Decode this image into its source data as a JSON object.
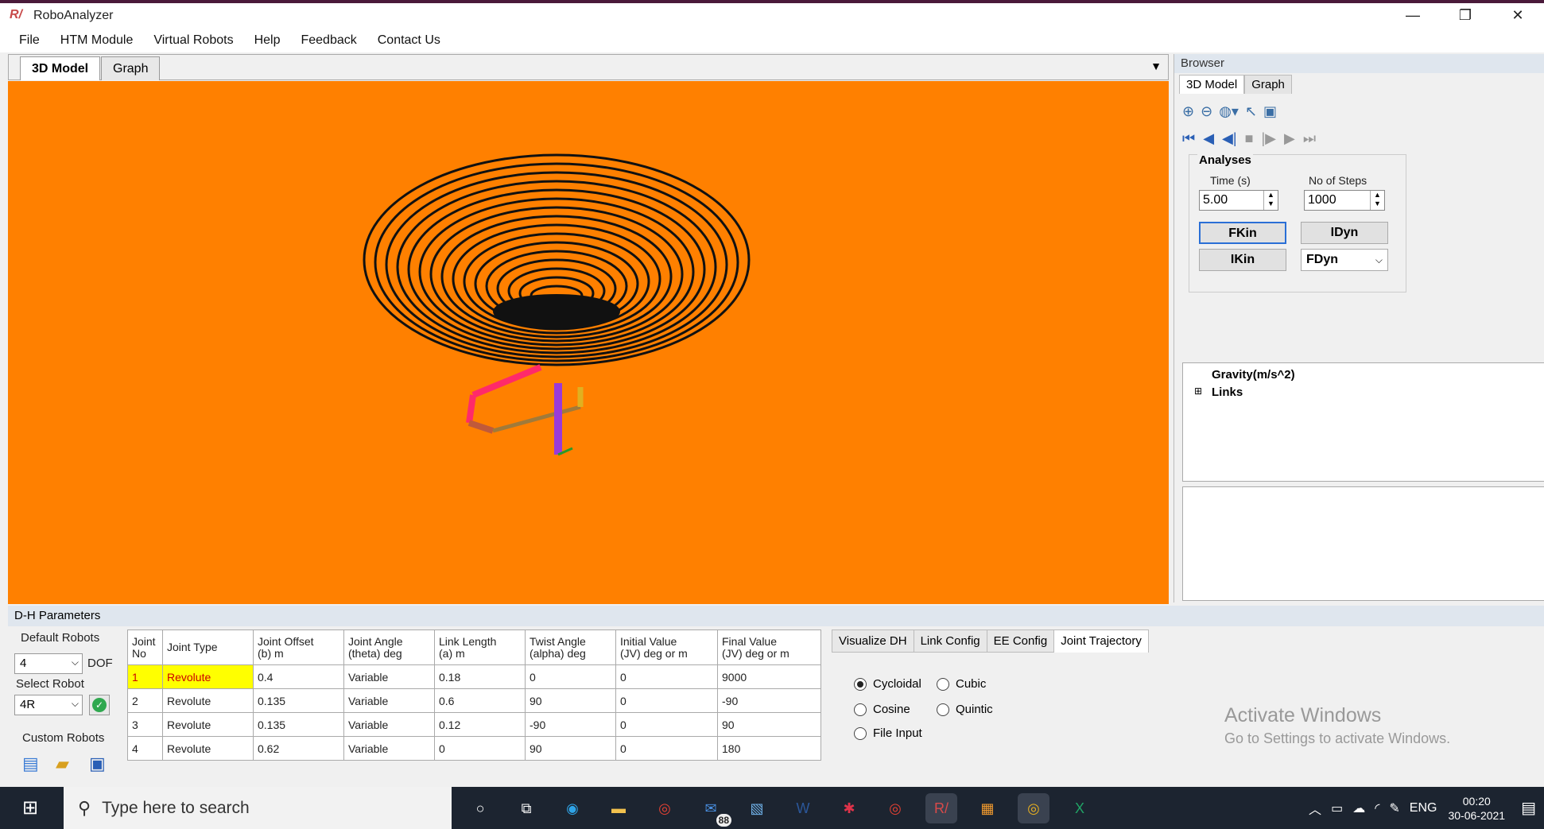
{
  "window": {
    "title": "RoboAnalyzer",
    "controls": [
      "—",
      "❐",
      "✕"
    ]
  },
  "menu": [
    "File",
    "HTM Module",
    "Virtual Robots",
    "Help",
    "Feedback",
    "Contact Us"
  ],
  "view_tabs": [
    "3D Model",
    "Graph"
  ],
  "browser": {
    "header": "Browser",
    "tabs": [
      "3D Model",
      "Graph"
    ],
    "analyses": {
      "title": "Analyses",
      "time_label": "Time (s)",
      "time_value": "5.00",
      "steps_label": "No of Steps",
      "steps_value": "1000",
      "buttons": {
        "fkin": "FKin",
        "idyn": "IDyn",
        "ikin": "IKin",
        "fdyn": "FDyn"
      }
    },
    "tree": {
      "gravity": "Gravity(m/s^2)",
      "links": "Links"
    }
  },
  "dh": {
    "header": "D-H Parameters",
    "default_robots_label": "Default Robots",
    "dof_value": "4",
    "dof_label": "DOF",
    "select_robot_label": "Select Robot",
    "robot_value": "4R",
    "custom_robots_label": "Custom Robots",
    "columns": [
      [
        "Joint",
        "No"
      ],
      [
        "Joint Type",
        ""
      ],
      [
        "Joint Offset",
        "(b) m"
      ],
      [
        "Joint Angle",
        "(theta) deg"
      ],
      [
        "Link Length",
        "(a) m"
      ],
      [
        "Twist Angle",
        "(alpha) deg"
      ],
      [
        "Initial Value",
        "(JV) deg or m"
      ],
      [
        "Final Value",
        "(JV) deg or m"
      ]
    ],
    "rows": [
      [
        "1",
        "Revolute",
        "0.4",
        "Variable",
        "0.18",
        "0",
        "0",
        "9000"
      ],
      [
        "2",
        "Revolute",
        "0.135",
        "Variable",
        "0.6",
        "90",
        "0",
        "-90"
      ],
      [
        "3",
        "Revolute",
        "0.135",
        "Variable",
        "0.12",
        "-90",
        "0",
        "90"
      ],
      [
        "4",
        "Revolute",
        "0.62",
        "Variable",
        "0",
        "90",
        "0",
        "180"
      ]
    ]
  },
  "right_tabs": [
    "Visualize DH",
    "Link Config",
    "EE Config",
    "Joint Trajectory"
  ],
  "trajectory_options": {
    "cycloidal": "Cycloidal",
    "cubic": "Cubic",
    "cosine": "Cosine",
    "quintic": "Quintic",
    "file_input": "File Input"
  },
  "watermark": {
    "line1": "Activate Windows",
    "line2": "Go to Settings to activate Windows."
  },
  "taskbar": {
    "search_placeholder": "Type here to search",
    "mail_badge": "88",
    "lang": "ENG",
    "time": "00:20",
    "date": "30-06-2021"
  },
  "colors": {
    "canvas": "#ff8000",
    "taskbar": "#1c2430",
    "highlight": "#ffff00"
  }
}
